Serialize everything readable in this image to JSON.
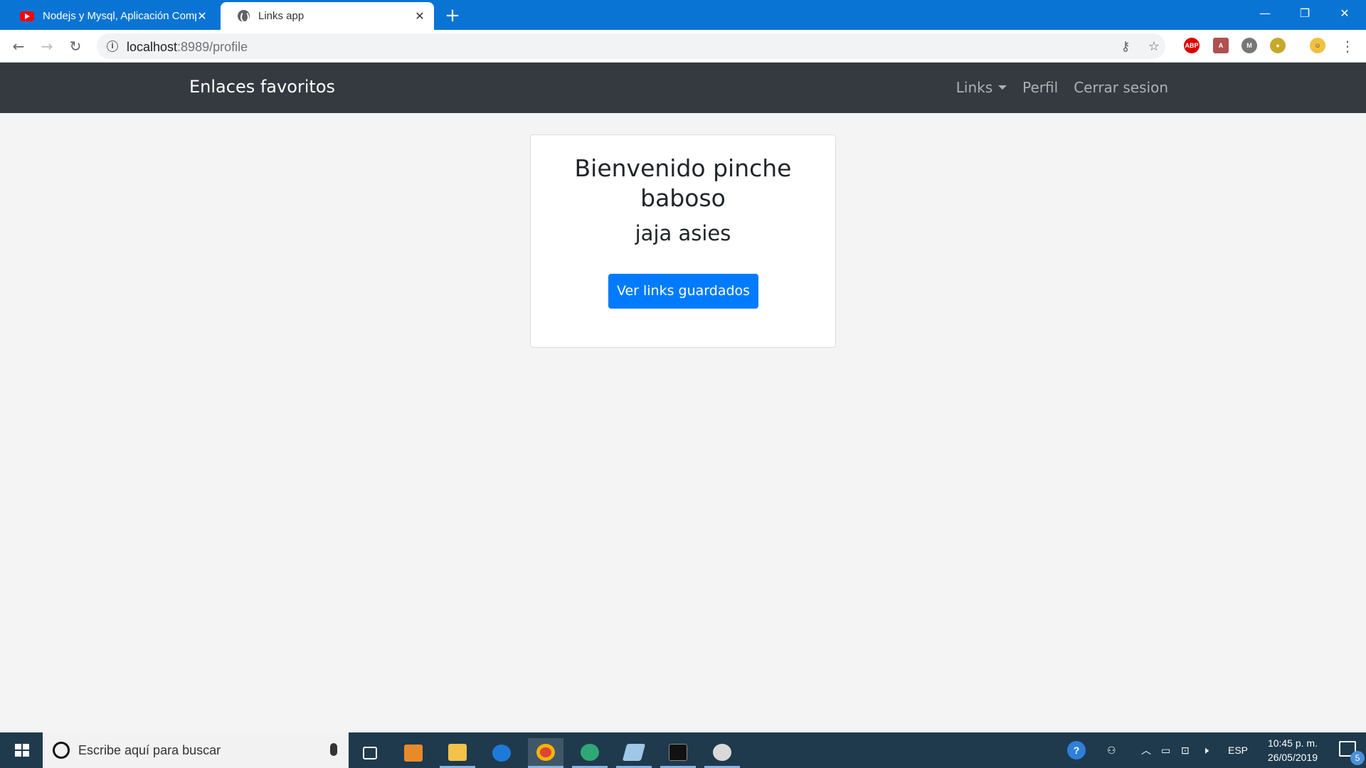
{
  "browser": {
    "tabs": [
      {
        "title": "Nodejs y Mysql, Aplicación Comp",
        "icon": "youtube-icon",
        "active": false
      },
      {
        "title": "Links app",
        "icon": "globe-icon",
        "active": true
      }
    ],
    "url_host": "localhost",
    "url_path": ":8989/profile"
  },
  "navbar": {
    "brand": "Enlaces favoritos",
    "links": [
      "Links",
      "Perfil",
      "Cerrar sesion"
    ]
  },
  "card": {
    "title": "Bienvenido pinche baboso",
    "subtitle": "jaja asies",
    "button": "Ver links guardados"
  },
  "taskbar": {
    "search_placeholder": "Escribe aquí para buscar",
    "language": "ESP",
    "time": "10:45 p. m.",
    "date": "26/05/2019",
    "notification_count": "5"
  },
  "colors": {
    "tabstrip": "#0a74d4",
    "navbar": "#343a40",
    "primary_button": "#007bff",
    "taskbar": "#1f3a4d"
  }
}
